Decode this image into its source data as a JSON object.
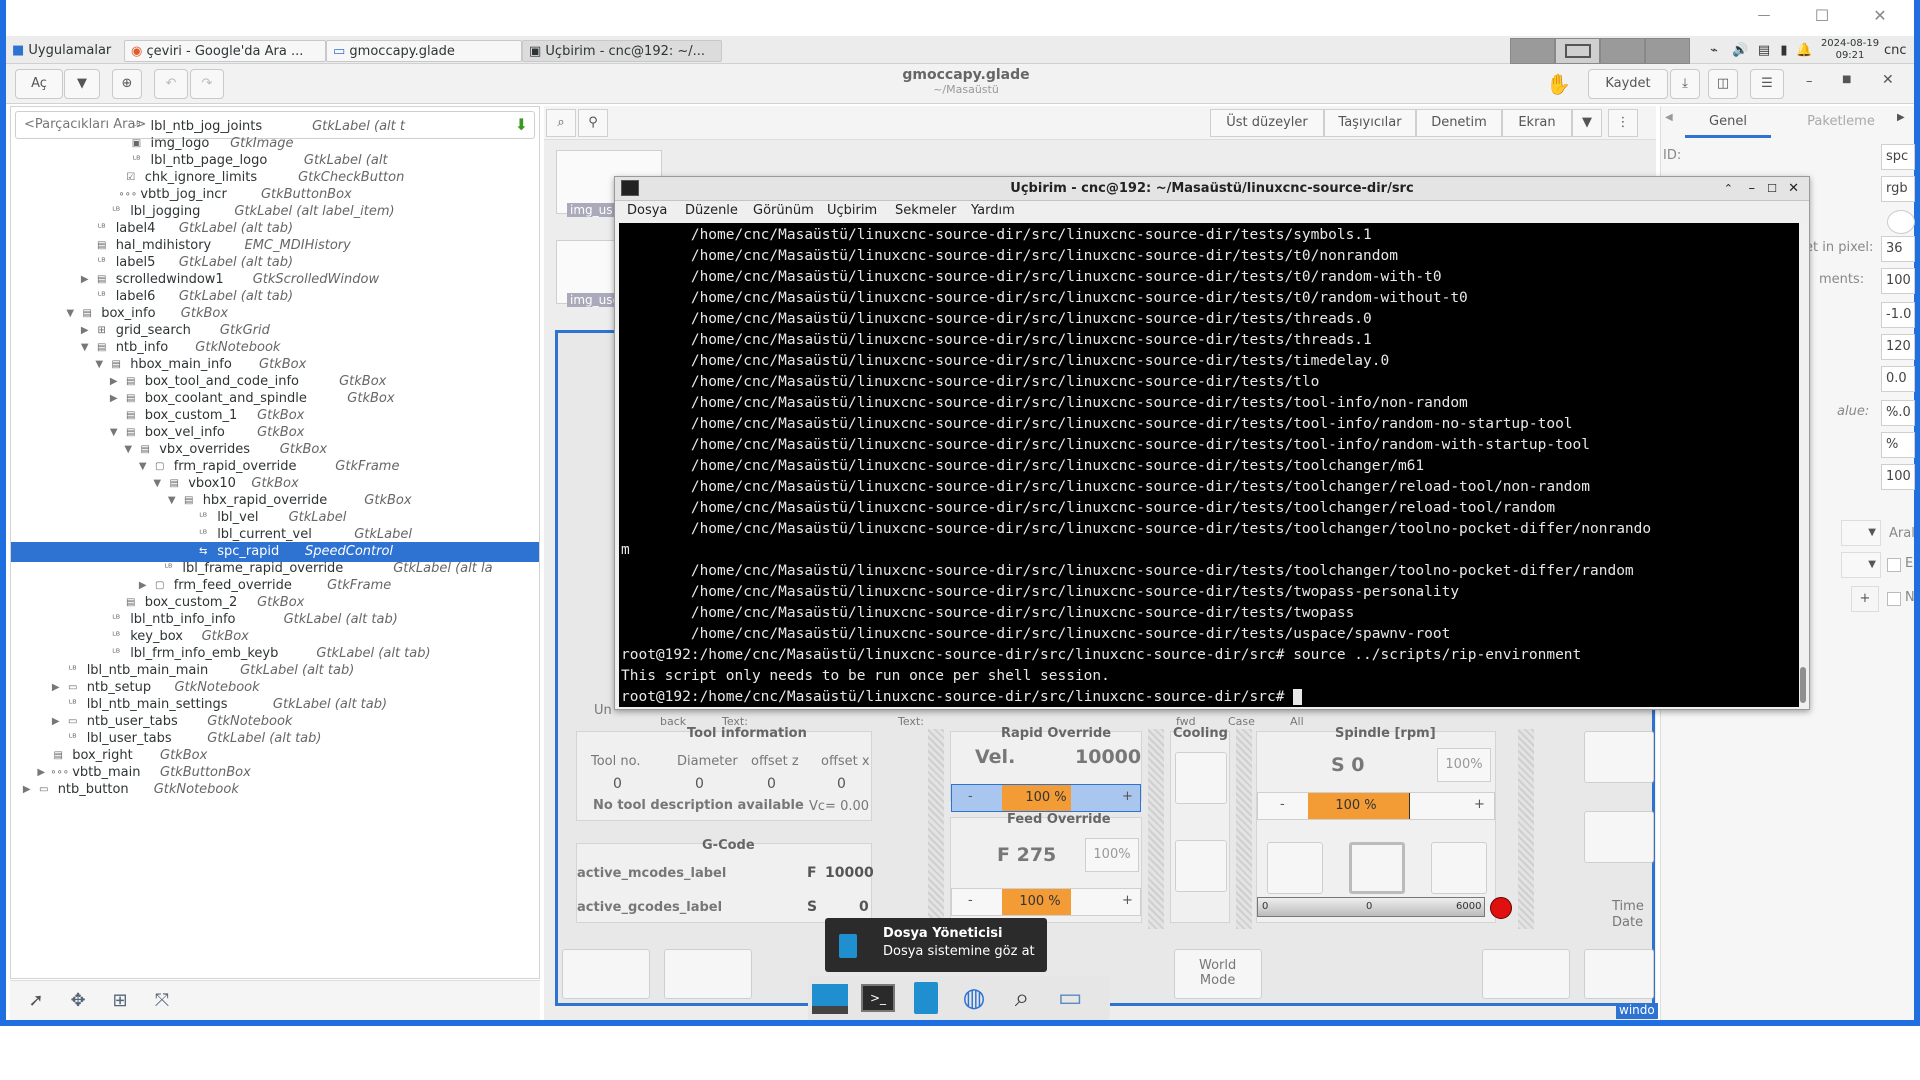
{
  "window_controls": {
    "minimize": "—",
    "maximize": "☐",
    "close": "✕"
  },
  "top_panel": {
    "apps_label": "Uygulamalar",
    "tasks": [
      {
        "label": "çeviri - Google'da Ara ..."
      },
      {
        "label": "gmoccapy.glade"
      },
      {
        "label": "Uçbirim - cnc@192: ~/..."
      }
    ],
    "datetime_date": "2024-08-19",
    "datetime_time": "09:21",
    "user": "cnc"
  },
  "glade_header": {
    "open_label": "Aç",
    "title": "gmoccapy.glade",
    "subtitle": "~/Masaüstü",
    "save_label": "Kaydet"
  },
  "left_panel": {
    "search_placeholder": "<Parçacıkları Ara>",
    "tree": [
      {
        "name": "lbl_ntb_jog_joints",
        "type": "GtkLabel (alt t",
        "level": 7,
        "exp": "",
        "ico": "label"
      },
      {
        "name": "img_logo",
        "type": "GtkImage",
        "level": 7,
        "exp": "",
        "ico": "image"
      },
      {
        "name": "lbl_ntb_page_logo",
        "type": "GtkLabel (alt",
        "level": 7,
        "exp": "",
        "ico": "label"
      },
      {
        "name": "chk_ignore_limits",
        "type": "GtkCheckButton",
        "level": 6.6,
        "exp": "",
        "ico": "check"
      },
      {
        "name": "vbtb_jog_incr",
        "type": "GtkButtonBox",
        "level": 6.3,
        "exp": "",
        "ico": "dots"
      },
      {
        "name": "lbl_jogging",
        "type": "GtkLabel (alt label_item)",
        "level": 5.6,
        "exp": "",
        "ico": "label"
      },
      {
        "name": "label4",
        "type": "GtkLabel (alt tab)",
        "level": 4.6,
        "exp": "",
        "ico": "label"
      },
      {
        "name": "hal_mdihistory",
        "type": "EMC_MDIHistory",
        "level": 4.6,
        "exp": "",
        "ico": "list"
      },
      {
        "name": "label5",
        "type": "GtkLabel (alt tab)",
        "level": 4.6,
        "exp": "",
        "ico": "label"
      },
      {
        "name": "scrolledwindow1",
        "type": "GtkScrolledWindow",
        "level": 4.6,
        "exp": "▶",
        "ico": "box"
      },
      {
        "name": "label6",
        "type": "GtkLabel (alt tab)",
        "level": 4.6,
        "exp": "",
        "ico": "label"
      },
      {
        "name": "box_info",
        "type": "GtkBox",
        "level": 3.6,
        "exp": "▼",
        "ico": "box"
      },
      {
        "name": "grid_search",
        "type": "GtkGrid",
        "level": 4.6,
        "exp": "▶",
        "ico": "grid"
      },
      {
        "name": "ntb_info",
        "type": "GtkNotebook",
        "level": 4.6,
        "exp": "▼",
        "ico": "box"
      },
      {
        "name": "hbox_main_info",
        "type": "GtkBox",
        "level": 5.6,
        "exp": "▼",
        "ico": "box"
      },
      {
        "name": "box_tool_and_code_info",
        "type": "GtkBox",
        "level": 6.6,
        "exp": "▶",
        "ico": "box"
      },
      {
        "name": "box_coolant_and_spindle",
        "type": "GtkBox",
        "level": 6.6,
        "exp": "▶",
        "ico": "box"
      },
      {
        "name": "box_custom_1",
        "type": "GtkBox",
        "level": 6.6,
        "exp": "",
        "ico": "box"
      },
      {
        "name": "box_vel_info",
        "type": "GtkBox",
        "level": 6.6,
        "exp": "▼",
        "ico": "box"
      },
      {
        "name": "vbx_overrides",
        "type": "GtkBox",
        "level": 7.6,
        "exp": "▼",
        "ico": "box"
      },
      {
        "name": "frm_rapid_override",
        "type": "GtkFrame",
        "level": 8.6,
        "exp": "▼",
        "ico": "frame"
      },
      {
        "name": "vbox10",
        "type": "GtkBox",
        "level": 9.6,
        "exp": "▼",
        "ico": "box"
      },
      {
        "name": "hbx_rapid_override",
        "type": "GtkBox",
        "level": 10.6,
        "exp": "▼",
        "ico": "box"
      },
      {
        "name": "lbl_vel",
        "type": "GtkLabel",
        "level": 11.6,
        "exp": "",
        "ico": "label"
      },
      {
        "name": "lbl_current_vel",
        "type": "GtkLabel",
        "level": 11.6,
        "exp": "",
        "ico": "label"
      },
      {
        "name": "spc_rapid",
        "type": "SpeedControl",
        "level": 11.6,
        "exp": "",
        "ico": "spin",
        "selected": true
      },
      {
        "name": "lbl_frame_rapid_override",
        "type": "GtkLabel (alt la",
        "level": 9.2,
        "exp": "",
        "ico": "label"
      },
      {
        "name": "frm_feed_override",
        "type": "GtkFrame",
        "level": 8.6,
        "exp": "▶",
        "ico": "frame"
      },
      {
        "name": "box_custom_2",
        "type": "GtkBox",
        "level": 6.6,
        "exp": "",
        "ico": "box"
      },
      {
        "name": "lbl_ntb_info_info",
        "type": "GtkLabel (alt tab)",
        "level": 5.6,
        "exp": "",
        "ico": "label"
      },
      {
        "name": "key_box",
        "type": "GtkBox",
        "level": 5.6,
        "exp": "",
        "ico": "label"
      },
      {
        "name": "lbl_frm_info_emb_keyb",
        "type": "GtkLabel (alt tab)",
        "level": 5.6,
        "exp": "",
        "ico": "label"
      },
      {
        "name": "lbl_ntb_main_main",
        "type": "GtkLabel (alt tab)",
        "level": 2.6,
        "exp": "",
        "ico": "label"
      },
      {
        "name": "ntb_setup",
        "type": "GtkNotebook",
        "level": 2.6,
        "exp": "▶",
        "ico": "folder"
      },
      {
        "name": "lbl_ntb_main_settings",
        "type": "GtkLabel (alt tab)",
        "level": 2.6,
        "exp": "",
        "ico": "label"
      },
      {
        "name": "ntb_user_tabs",
        "type": "GtkNotebook",
        "level": 2.6,
        "exp": "▶",
        "ico": "folder"
      },
      {
        "name": "lbl_user_tabs",
        "type": "GtkLabel (alt tab)",
        "level": 2.6,
        "exp": "",
        "ico": "label"
      },
      {
        "name": "box_right",
        "type": "GtkBox",
        "level": 1.6,
        "exp": "",
        "ico": "box"
      },
      {
        "name": "vbtb_main",
        "type": "GtkButtonBox",
        "level": 1.6,
        "exp": "▶",
        "ico": "dots"
      },
      {
        "name": "ntb_button",
        "type": "GtkNotebook",
        "level": 0.6,
        "exp": "▶",
        "ico": "folder"
      }
    ]
  },
  "mid_toolbar": {
    "tabs": [
      "Üst düzeyler",
      "Taşıyıcılar",
      "Denetim",
      "Ekran"
    ]
  },
  "right_panel": {
    "tab_general": "Genel",
    "tab_package": "Paketleme",
    "id_label": "ID:",
    "labels": [
      "et in pixel:",
      "ments:",
      "alue:",
      "Aral",
      "E",
      "N"
    ],
    "fields": [
      "spc",
      "rgb",
      "36",
      "100",
      "-1.0",
      "120",
      "0.0",
      "%.0",
      "%",
      "100"
    ]
  },
  "terminal": {
    "title": "Uçbirim - cnc@192: ~/Masaüstü/linuxcnc-source-dir/src",
    "menus": [
      "Dosya",
      "Düzenle",
      "Görünüm",
      "Uçbirim",
      "Sekmeler",
      "Yardım"
    ],
    "lines": [
      "        /home/cnc/Masaüstü/linuxcnc-source-dir/src/linuxcnc-source-dir/tests/symbols.1",
      "        /home/cnc/Masaüstü/linuxcnc-source-dir/src/linuxcnc-source-dir/tests/t0/nonrandom",
      "        /home/cnc/Masaüstü/linuxcnc-source-dir/src/linuxcnc-source-dir/tests/t0/random-with-t0",
      "        /home/cnc/Masaüstü/linuxcnc-source-dir/src/linuxcnc-source-dir/tests/t0/random-without-t0",
      "        /home/cnc/Masaüstü/linuxcnc-source-dir/src/linuxcnc-source-dir/tests/threads.0",
      "        /home/cnc/Masaüstü/linuxcnc-source-dir/src/linuxcnc-source-dir/tests/threads.1",
      "        /home/cnc/Masaüstü/linuxcnc-source-dir/src/linuxcnc-source-dir/tests/timedelay.0",
      "        /home/cnc/Masaüstü/linuxcnc-source-dir/src/linuxcnc-source-dir/tests/tlo",
      "        /home/cnc/Masaüstü/linuxcnc-source-dir/src/linuxcnc-source-dir/tests/tool-info/non-random",
      "        /home/cnc/Masaüstü/linuxcnc-source-dir/src/linuxcnc-source-dir/tests/tool-info/random-no-startup-tool",
      "        /home/cnc/Masaüstü/linuxcnc-source-dir/src/linuxcnc-source-dir/tests/tool-info/random-with-startup-tool",
      "        /home/cnc/Masaüstü/linuxcnc-source-dir/src/linuxcnc-source-dir/tests/toolchanger/m61",
      "        /home/cnc/Masaüstü/linuxcnc-source-dir/src/linuxcnc-source-dir/tests/toolchanger/reload-tool/non-random",
      "        /home/cnc/Masaüstü/linuxcnc-source-dir/src/linuxcnc-source-dir/tests/toolchanger/reload-tool/random",
      "        /home/cnc/Masaüstü/linuxcnc-source-dir/src/linuxcnc-source-dir/tests/toolchanger/toolno-pocket-differ/nonrando",
      "m",
      "        /home/cnc/Masaüstü/linuxcnc-source-dir/src/linuxcnc-source-dir/tests/toolchanger/toolno-pocket-differ/random",
      "        /home/cnc/Masaüstü/linuxcnc-source-dir/src/linuxcnc-source-dir/tests/twopass-personality",
      "        /home/cnc/Masaüstü/linuxcnc-source-dir/src/linuxcnc-source-dir/tests/twopass",
      "        /home/cnc/Masaüstü/linuxcnc-source-dir/src/linuxcnc-source-dir/tests/uspace/spawnv-root",
      "root@192:/home/cnc/Masaüstü/linuxcnc-source-dir/src/linuxcnc-source-dir/src# source ../scripts/rip-environment",
      "This script only needs to be run once per shell session.",
      "root@192:/home/cnc/Masaüstü/linuxcnc-source-dir/src/linuxcnc-source-dir/src# "
    ]
  },
  "gmoccapy": {
    "thumb1": "img_us",
    "thumb2": "img_use",
    "search_partial": {
      "un": "Un",
      "back": "back",
      "text1": "Text:",
      "text2": "Text:",
      "fwd": "fwd",
      "case": "Case",
      "all": "All"
    },
    "tool_info": {
      "title": "Tool information",
      "headers": [
        "Tool no.",
        "Diameter",
        "offset z",
        "offset x"
      ],
      "values": [
        "0",
        "0",
        "0",
        "0"
      ],
      "description": "No tool description available",
      "vc": "Vc= 0.00"
    },
    "gcode": {
      "title": "G-Code",
      "mcodes": "active_mcodes_label",
      "gcodes": "active_gcodes_label",
      "f_label": "F",
      "f_value": "10000",
      "s_label": "S",
      "s_value": "0"
    },
    "rapid": {
      "title": "Rapid Override",
      "vel_label": "Vel.",
      "vel_value": "10000",
      "pct_text": "100 %",
      "pct": 70,
      "minus": "-",
      "plus": "+"
    },
    "feed": {
      "title": "Feed Override",
      "f_text": "F 275",
      "pct_box": "100%",
      "pct_text": "100 %",
      "pct": 70,
      "minus": "-",
      "plus": "+"
    },
    "cooling": {
      "title": "Cooling"
    },
    "spindle": {
      "title": "Spindle [rpm]",
      "s_text": "S 0",
      "pct_box": "100%",
      "pct_text": "100 %",
      "pct": 70,
      "minus": "-",
      "plus": "+",
      "gauge_min": "0",
      "gauge_mid": "0",
      "gauge_max": "6000",
      "led_color": "#e01010"
    },
    "time_label": "Time",
    "date_label": "Date",
    "world_mode": "World\nMode",
    "window_label": "windo"
  },
  "dock": {
    "tooltip_title": "Dosya Yöneticisi",
    "tooltip_desc": "Dosya sistemine göz at"
  },
  "colors": {
    "selection": "#2e72d2",
    "override_fill": "#f39c36",
    "desktop_frame": "#1f6fe0"
  }
}
